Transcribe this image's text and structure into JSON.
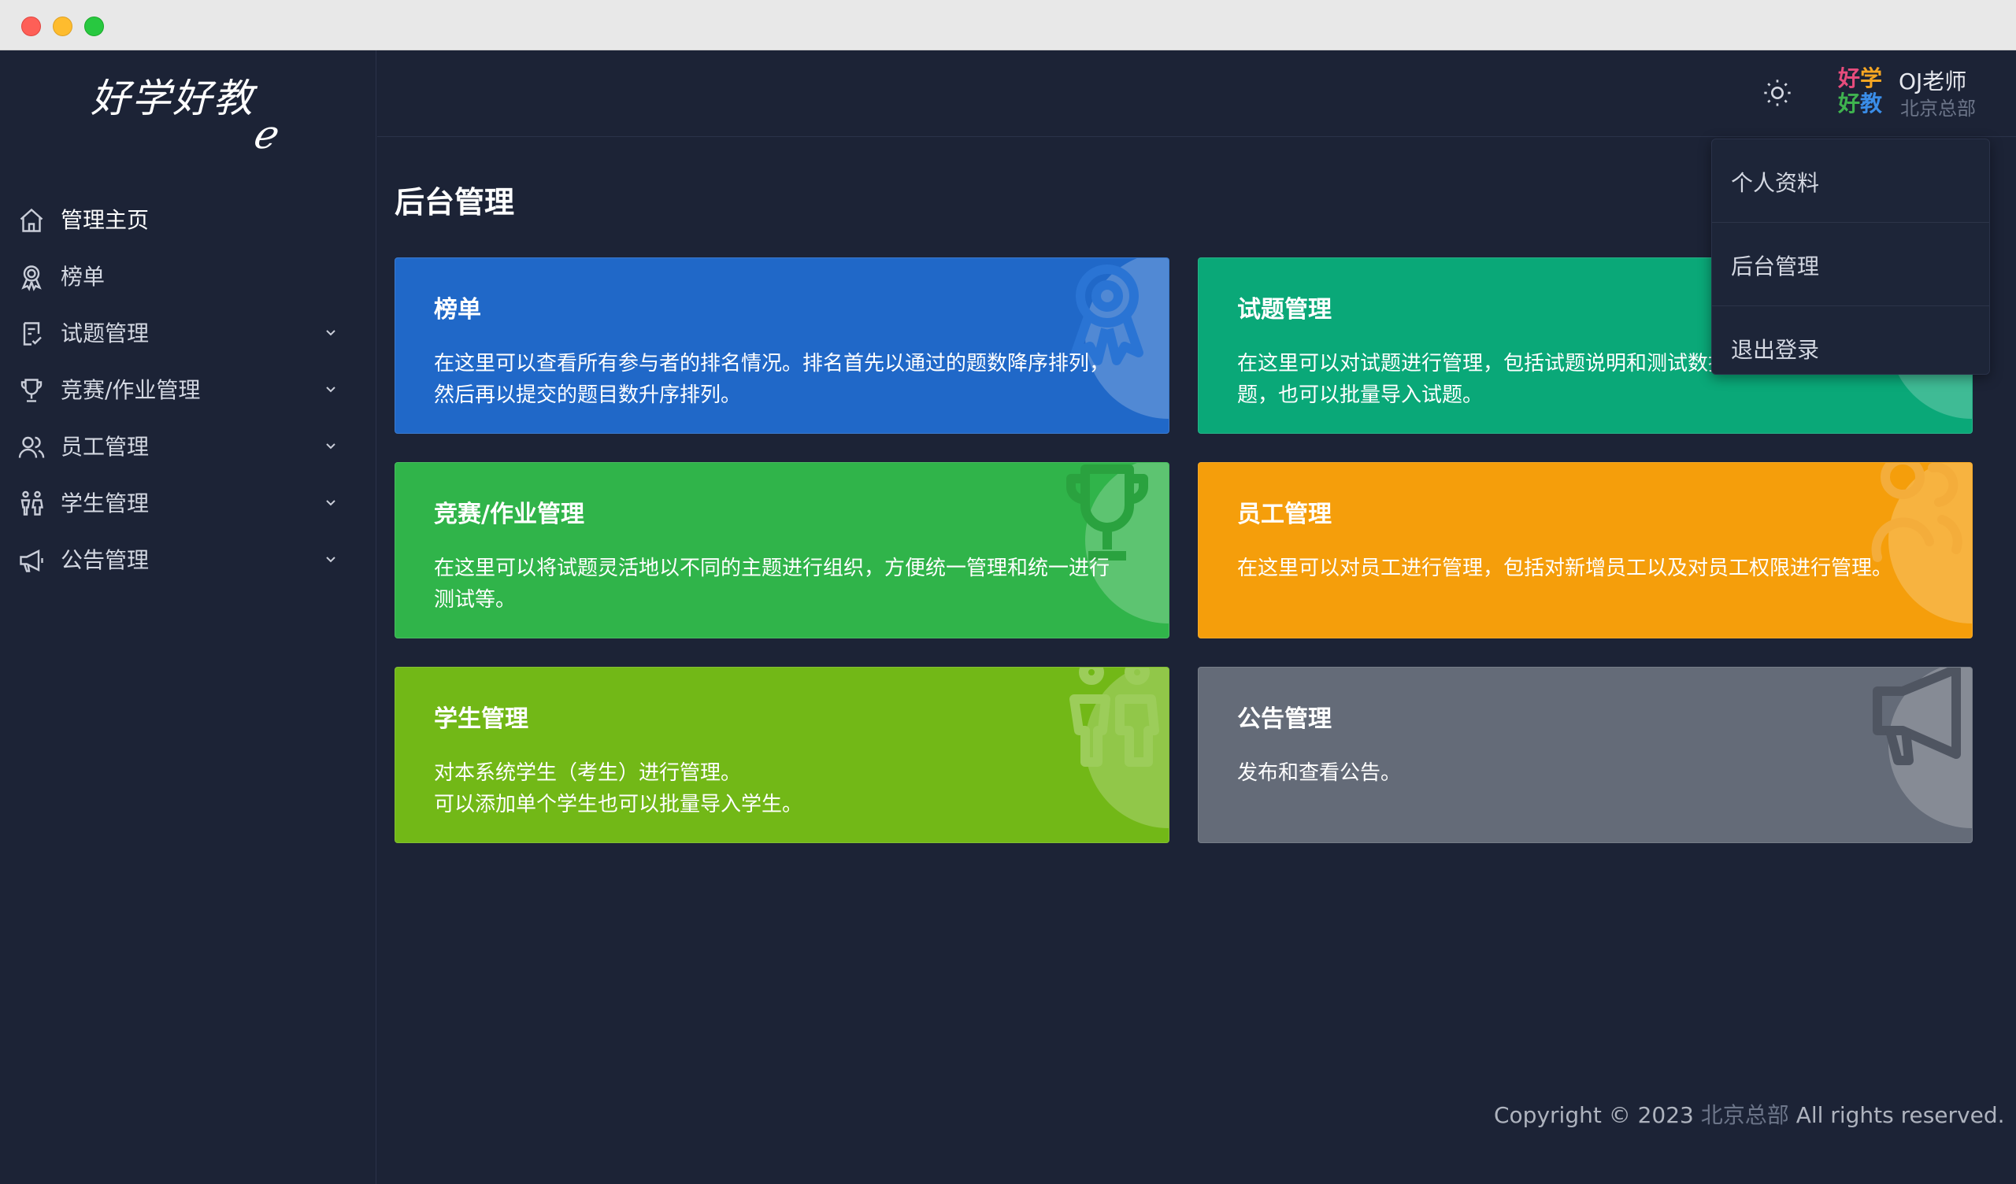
{
  "sidebar": {
    "logo": "好学好教",
    "items": [
      {
        "label": "管理主页",
        "icon": "home-icon"
      },
      {
        "label": "榜单",
        "icon": "award-icon"
      },
      {
        "label": "试题管理",
        "icon": "document-icon",
        "expandable": true
      },
      {
        "label": "竞赛/作业管理",
        "icon": "trophy-icon",
        "expandable": true
      },
      {
        "label": "员工管理",
        "icon": "users-icon",
        "expandable": true
      },
      {
        "label": "学生管理",
        "icon": "students-icon",
        "expandable": true
      },
      {
        "label": "公告管理",
        "icon": "megaphone-icon",
        "expandable": true
      }
    ]
  },
  "header": {
    "theme_icon": "sun-icon",
    "avatar_text": "好学好教",
    "user_name": "OJ老师",
    "user_org": "北京总部"
  },
  "dropdown": {
    "items": [
      "个人资料",
      "后台管理",
      "退出登录"
    ]
  },
  "main": {
    "title": "后台管理",
    "cards": [
      {
        "title": "榜单",
        "desc": "在这里可以查看所有参与者的排名情况。排名首先以通过的题数降序排列，然后再以提交的题目数升序排列。",
        "color": "#2068c8",
        "icon": "award-icon"
      },
      {
        "title": "试题管理",
        "desc": "在这里可以对试题进行管理，包括试题说明和测试数据，也可以新增一道试题，也可以批量导入试题。",
        "color": "#0aa878",
        "icon": "document-icon"
      },
      {
        "title": "竞赛/作业管理",
        "desc": "在这里可以将试题灵活地以不同的主题进行组织，方便统一管理和统一进行测试等。",
        "color": "#30b44a",
        "icon": "trophy-icon"
      },
      {
        "title": "员工管理",
        "desc": "在这里可以对员工进行管理，包括对新增员工以及对员工权限进行管理。",
        "color": "#f59e0b",
        "icon": "users-icon"
      },
      {
        "title": "学生管理",
        "desc_line1": "对本系统学生（考生）进行管理。",
        "desc_line2": "可以添加单个学生也可以批量导入学生。",
        "color": "#72b817",
        "icon": "students-icon"
      },
      {
        "title": "公告管理",
        "desc": "发布和查看公告。",
        "color": "#646b78",
        "icon": "megaphone-icon"
      }
    ]
  },
  "footer": {
    "prefix": "Copyright © 2023 ",
    "org": "北京总部",
    "suffix": " All rights reserved."
  }
}
